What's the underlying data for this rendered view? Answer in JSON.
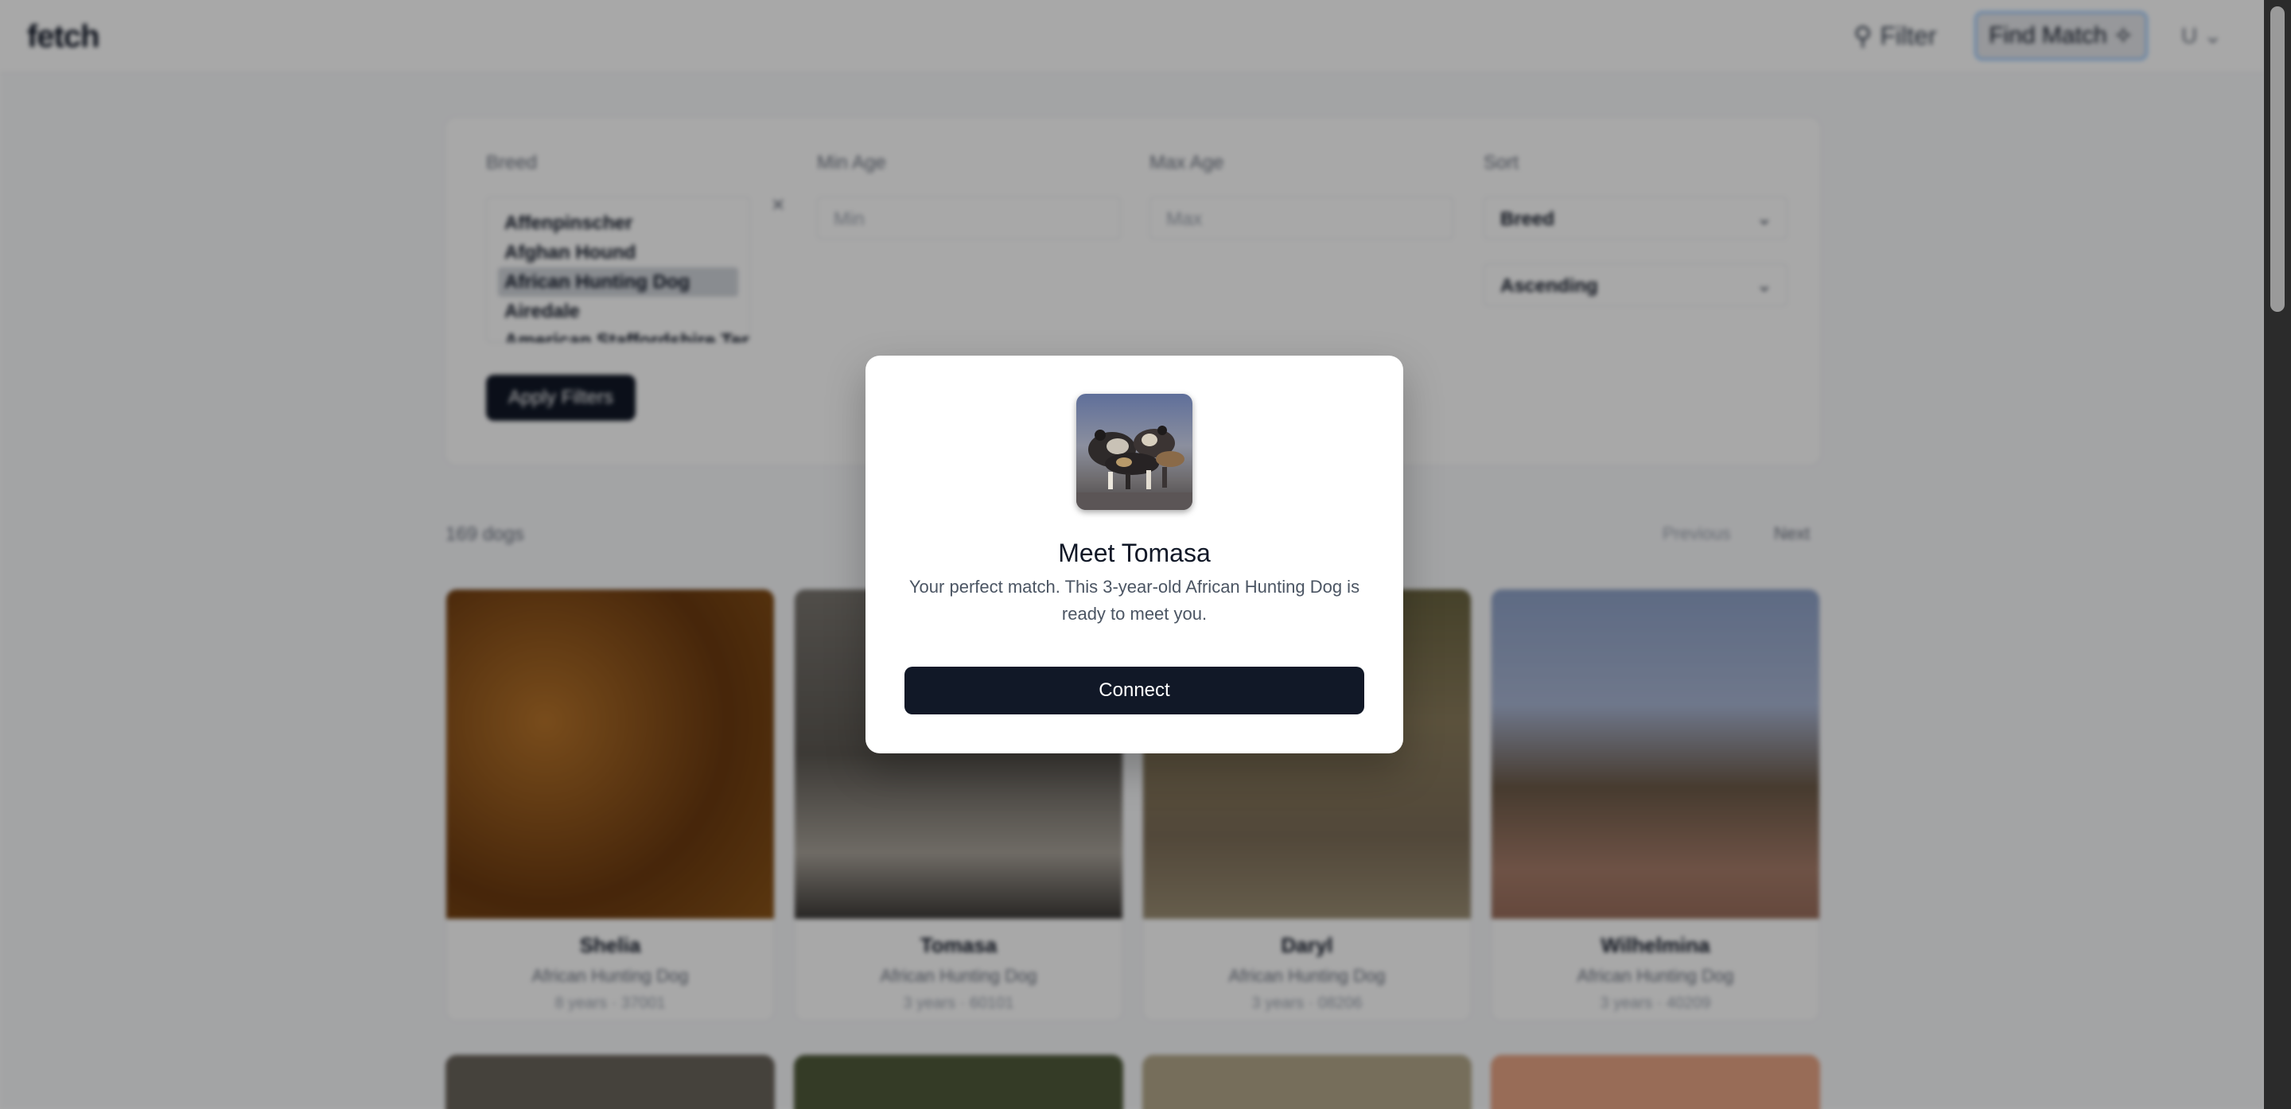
{
  "app": {
    "logo": "fetch"
  },
  "nav": {
    "filter_label": "Filter",
    "find_match_label": "Find Match",
    "user_label": "U"
  },
  "filters": {
    "breed_label": "Breed",
    "breeds": [
      "Affenpinscher",
      "Afghan Hound",
      "African Hunting Dog",
      "Airedale",
      "American Staffordshire Terrier"
    ],
    "selected_breed": "African Hunting Dog",
    "min_age_label": "Min Age",
    "min_age_placeholder": "Min",
    "max_age_label": "Max Age",
    "max_age_placeholder": "Max",
    "sort_label": "Sort",
    "sort_field": "Breed",
    "sort_order": "Ascending",
    "apply_label": "Apply Filters"
  },
  "results": {
    "count_text": "169 dogs",
    "prev_label": "Previous",
    "next_label": "Next"
  },
  "dogs": [
    {
      "name": "Shelia",
      "breed": "African Hunting Dog",
      "meta": "8 years · 37001"
    },
    {
      "name": "Tomasa",
      "breed": "African Hunting Dog",
      "meta": "3 years · 60101"
    },
    {
      "name": "Daryl",
      "breed": "African Hunting Dog",
      "meta": "3 years · 08206"
    },
    {
      "name": "Wilhelmina",
      "breed": "African Hunting Dog",
      "meta": "3 years · 40209"
    }
  ],
  "modal": {
    "title": "Meet Tomasa",
    "message": "Your perfect match. This 3-year-old African Hunting Dog is ready to meet you.",
    "button_label": "Connect"
  },
  "colors": {
    "primary": "#111827",
    "overlay": "rgba(0,0,0,0.34)",
    "muted_text": "#4b5563"
  },
  "icons": {
    "filter": "filter-icon",
    "match": "sparkle-icon",
    "chevron": "chevron-down-icon",
    "close": "close-icon"
  }
}
